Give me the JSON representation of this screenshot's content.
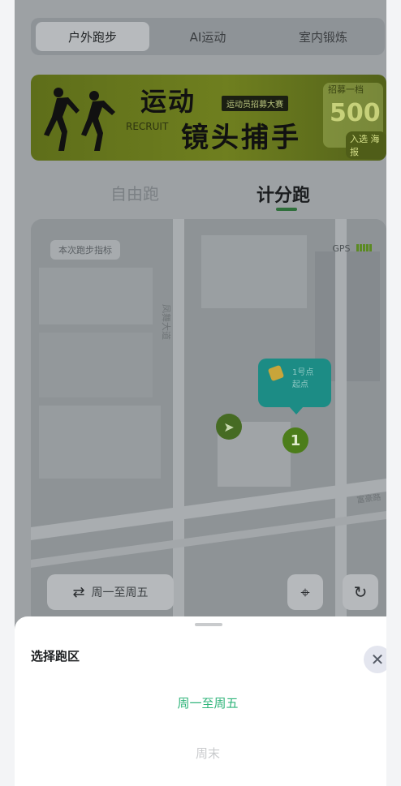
{
  "top_tabs": [
    {
      "label": "户外跑步",
      "active": true
    },
    {
      "label": "AI运动",
      "active": false
    },
    {
      "label": "室内锻炼",
      "active": false
    }
  ],
  "banner": {
    "title_line1": "运动",
    "title_line2": "镜头捕手",
    "english": "RECRUIT",
    "badge": "运动员招募大赛",
    "right_small": "招募一档",
    "right_number": "500",
    "right_sub": "入选 海报"
  },
  "mode_tabs": {
    "free": "自由跑",
    "score": "计分跑",
    "active": "score"
  },
  "map": {
    "area_label": "本次跑步指标",
    "gps_label": "GPS",
    "road_label_1": "凤舞大道",
    "road_label_2": "富豪路",
    "marker_text": "1号点",
    "marker_sub": "起点",
    "checkpoint_number": "1",
    "schedule_button": "周一至周五"
  },
  "sheet": {
    "title": "选择跑区",
    "options": [
      "周一至周五",
      "周末"
    ],
    "selected": "周一至周五"
  },
  "colors": {
    "selected_option": "#2fb47a",
    "checkpoint": "#4c7d1a",
    "marker": "#1c8c85"
  }
}
